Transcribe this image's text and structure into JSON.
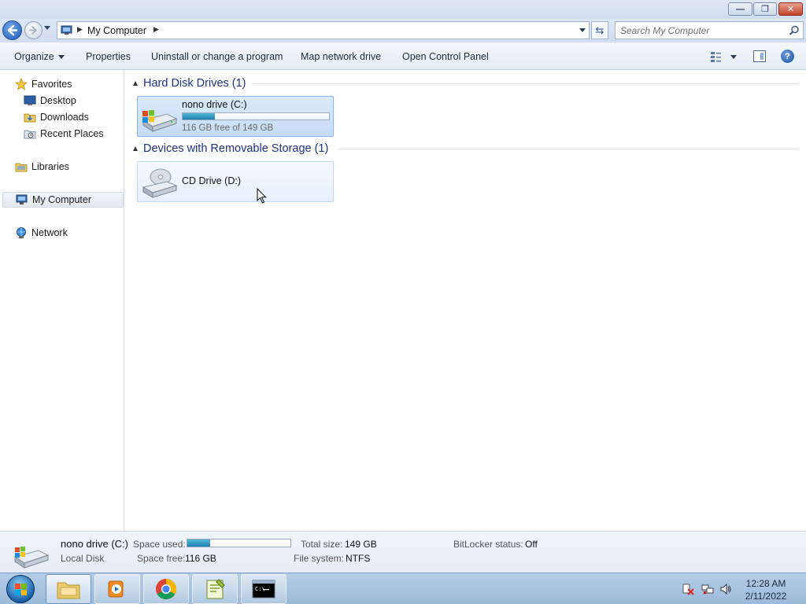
{
  "window": {
    "minimize_label": "—",
    "restore_label": "❐",
    "close_label": "✕"
  },
  "address_bar": {
    "path": "My Computer",
    "search_placeholder": "Search My Computer"
  },
  "toolbar": {
    "organize": "Organize",
    "properties": "Properties",
    "uninstall": "Uninstall or change a program",
    "map_drive": "Map network drive",
    "control_panel": "Open Control Panel"
  },
  "nav": {
    "favorites": "Favorites",
    "desktop": "Desktop",
    "downloads": "Downloads",
    "recent_places": "Recent Places",
    "libraries": "Libraries",
    "my_computer": "My Computer",
    "network": "Network"
  },
  "groups": {
    "hard_disk": "Hard Disk Drives (1)",
    "removable": "Devices with Removable Storage (1)"
  },
  "drives": {
    "c": {
      "name": "nono drive (C:)",
      "free_text": "116 GB free of 149 GB",
      "used_fraction": 0.22
    },
    "d": {
      "name": "CD Drive (D:)"
    }
  },
  "details": {
    "name": "nono drive (C:)",
    "type": "Local Disk",
    "space_used_label": "Space used:",
    "space_used_fraction": 0.22,
    "space_free_label": "Space free:",
    "space_free_value": "116 GB",
    "total_size_label": "Total size:",
    "total_size_value": "149 GB",
    "file_system_label": "File system:",
    "file_system_value": "NTFS",
    "bitlocker_label": "BitLocker status:",
    "bitlocker_value": "Off"
  },
  "taskbar": {
    "time": "12:28 AM",
    "date": "2/11/2022"
  },
  "colors": {
    "group_title": "#1e3287",
    "progress": "#26a0da",
    "selection": "#cce2f8"
  }
}
